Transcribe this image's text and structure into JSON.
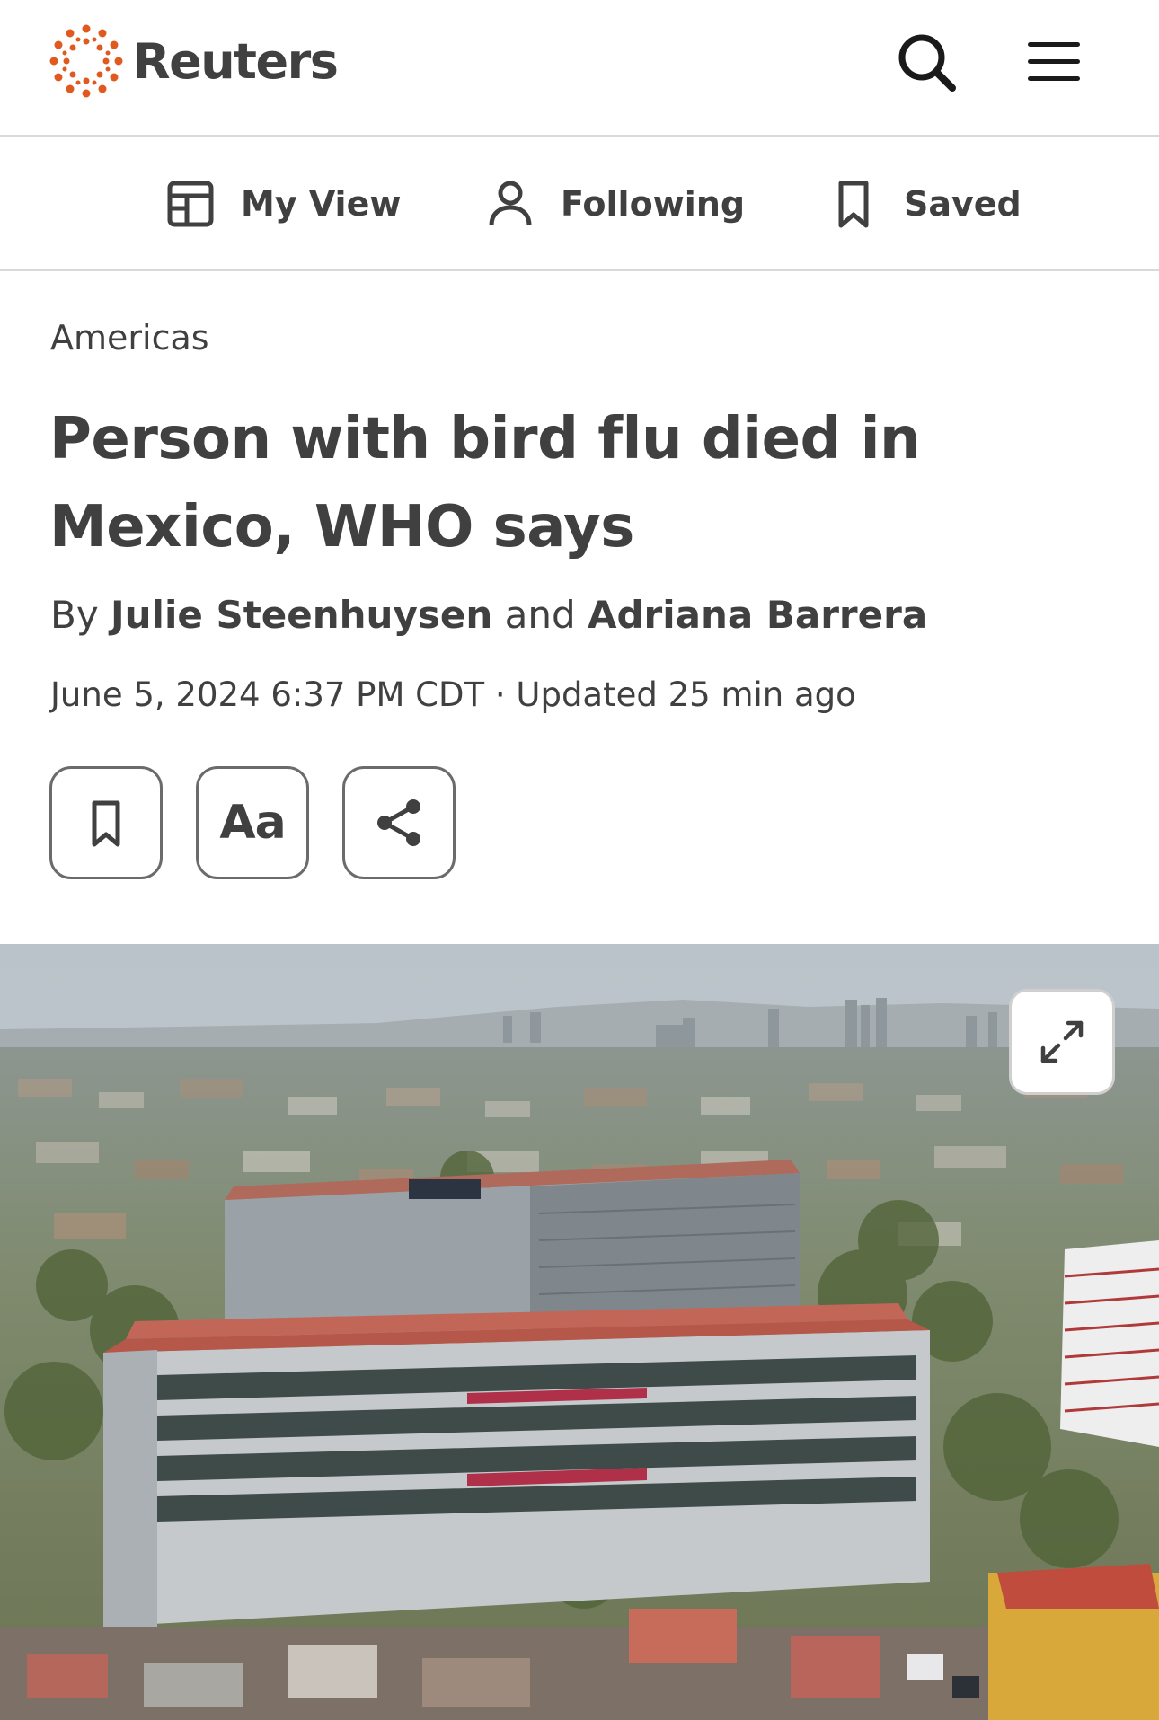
{
  "header": {
    "brand": "Reuters",
    "logo_icon": "reuters-dot-ring-icon",
    "brand_color": "#e05a1f",
    "search_icon": "search-icon",
    "menu_icon": "hamburger-menu-icon"
  },
  "subnav": {
    "items": [
      {
        "label": "My View",
        "icon": "layout-icon"
      },
      {
        "label": "Following",
        "icon": "person-icon"
      },
      {
        "label": "Saved",
        "icon": "bookmark-icon"
      }
    ]
  },
  "article": {
    "section": "Americas",
    "headline": "Person with bird flu died in Mexico, WHO says",
    "byline": {
      "prefix": "By",
      "author1": "Julie Steenhuysen",
      "conjunction": "and",
      "author2": "Adriana Barrera"
    },
    "dateline": "June 5, 2024 6:37 PM CDT · Updated 25 min ago",
    "tools": {
      "bookmark_icon": "bookmark-icon",
      "text_size_label": "Aa",
      "share_icon": "share-icon"
    }
  },
  "photo": {
    "expand_icon": "expand-icon"
  }
}
